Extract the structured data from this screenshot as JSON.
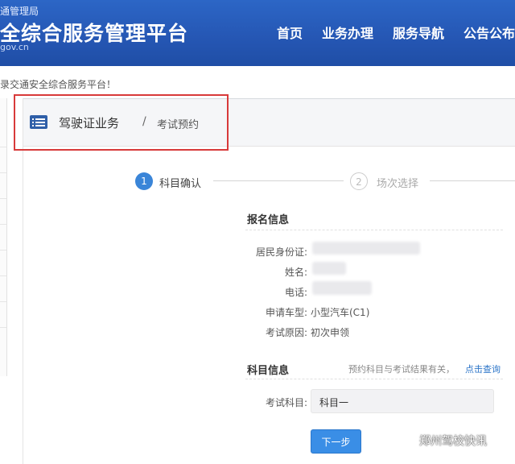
{
  "header": {
    "org_name": "通管理局",
    "platform_title": "全综合服务管理平台",
    "domain": "gov.cn",
    "nav": [
      "首页",
      "业务办理",
      "服务导航",
      "公告公布"
    ]
  },
  "welcome_text": "录交通安全综合服务平台！",
  "breadcrumb": {
    "section": "驾驶证业务",
    "separator": "/",
    "current": "考试预约"
  },
  "steps": [
    {
      "number": "1",
      "label": "科目确认",
      "active": true
    },
    {
      "number": "2",
      "label": "场次选择",
      "active": false
    }
  ],
  "registration": {
    "title": "报名信息",
    "fields": [
      {
        "label": "居民身份证:",
        "value": ""
      },
      {
        "label": "姓名:",
        "value": ""
      },
      {
        "label": "电话:",
        "value": ""
      },
      {
        "label": "申请车型:",
        "value": "小型汽车(C1)"
      },
      {
        "label": "考试原因:",
        "value": "初次申领"
      }
    ]
  },
  "subject": {
    "title": "科目信息",
    "note": "预约科目与考试结果有关，",
    "link": "点击查询",
    "field_label": "考试科目:",
    "field_value": "科目一"
  },
  "next_button": "下一步",
  "watermark": "郑州驾校快讯",
  "colors": {
    "header_blue": "#2556b3",
    "accent_blue": "#3a8ee6",
    "highlight_red": "#d83a3a"
  }
}
